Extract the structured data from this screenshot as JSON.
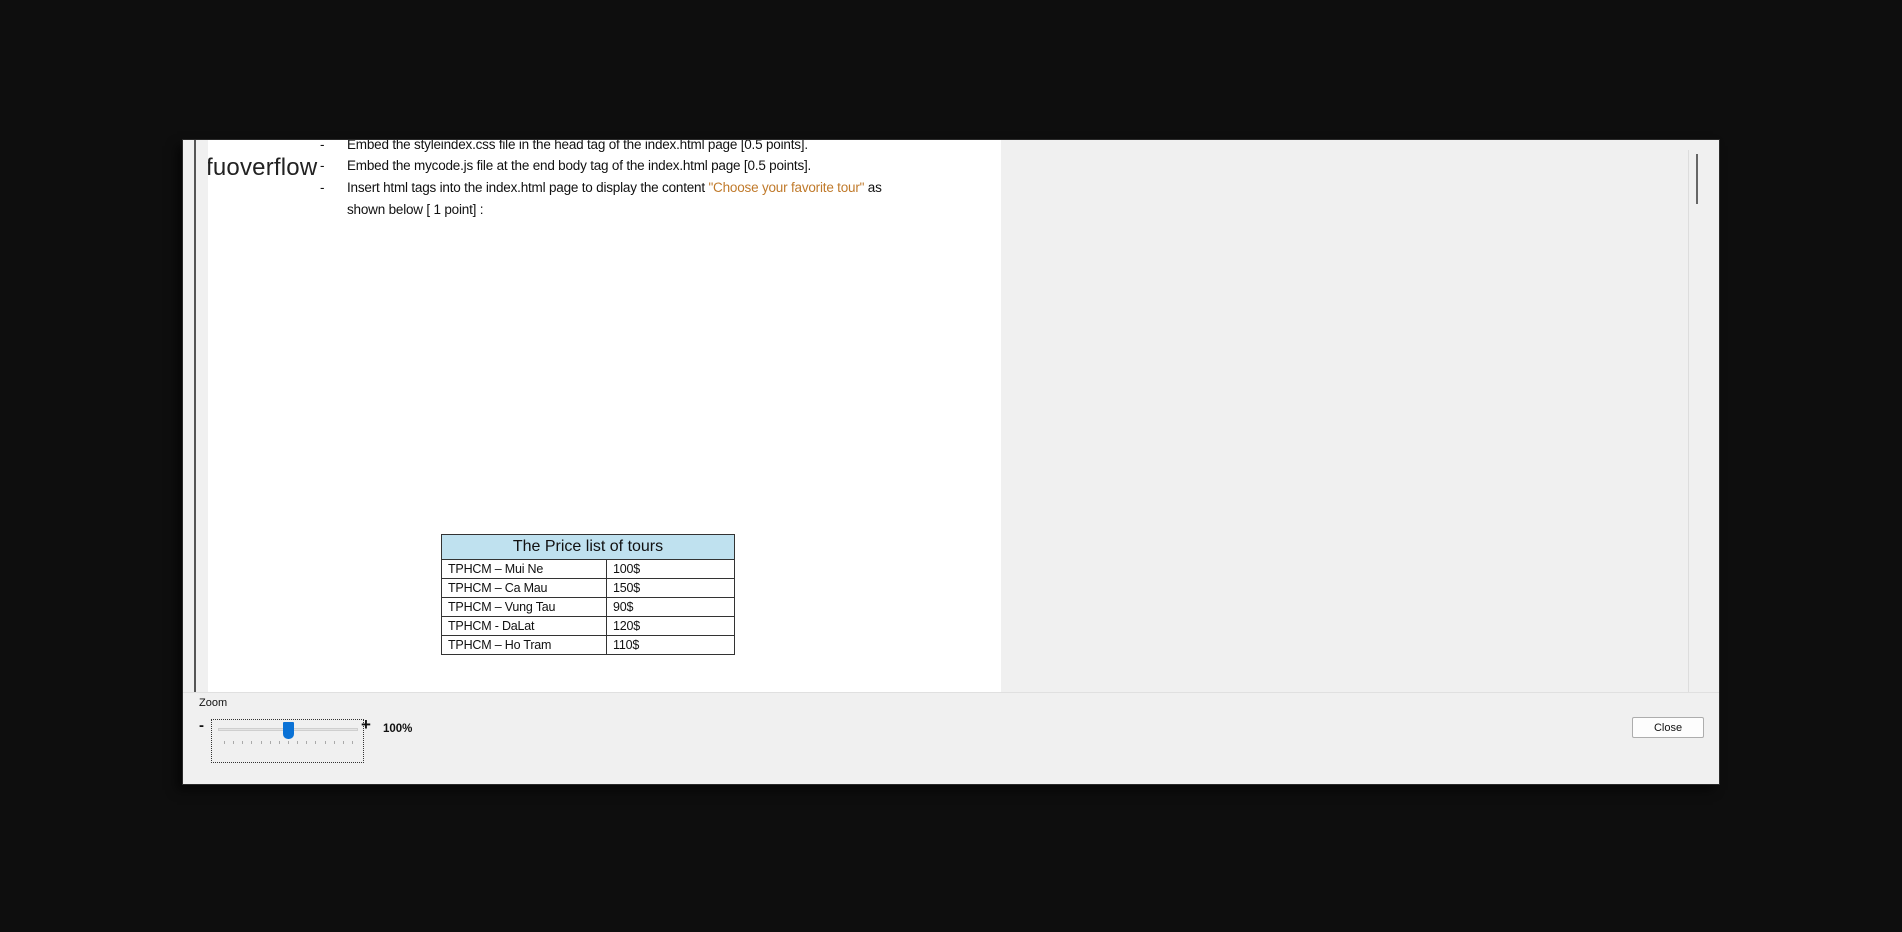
{
  "watermark": "fuoverflow",
  "instructions": [
    {
      "bullet": "-",
      "text": "Embed the styleindex.css file in the head tag of the index.html page [0.5 points]."
    },
    {
      "bullet": "-",
      "text": "Embed the mycode.js file at the end body tag of the index.html page [0.5 points]."
    },
    {
      "bullet": "-",
      "text_before": "Insert html tags into the index.html page to display the content ",
      "highlight": "\"Choose your favorite tour\"",
      "text_after": " as",
      "continuation": "shown below [ 1 point] :"
    }
  ],
  "price_table": {
    "title": "The Price list of tours",
    "rows": [
      {
        "tour": "TPHCM – Mui Ne",
        "price": "100$"
      },
      {
        "tour": "TPHCM – Ca Mau",
        "price": "150$"
      },
      {
        "tour": "TPHCM – Vung Tau",
        "price": "90$"
      },
      {
        "tour": "TPHCM - DaLat",
        "price": "120$"
      },
      {
        "tour": "TPHCM – Ho Tram",
        "price": "110$"
      }
    ],
    "header_color": "#bfe1ef"
  },
  "zoom": {
    "label": "Zoom",
    "minus": "-",
    "plus": "+",
    "value": "100%",
    "level_fraction": 0.5
  },
  "close_label": "Close",
  "accent_color": "#0a72d6"
}
